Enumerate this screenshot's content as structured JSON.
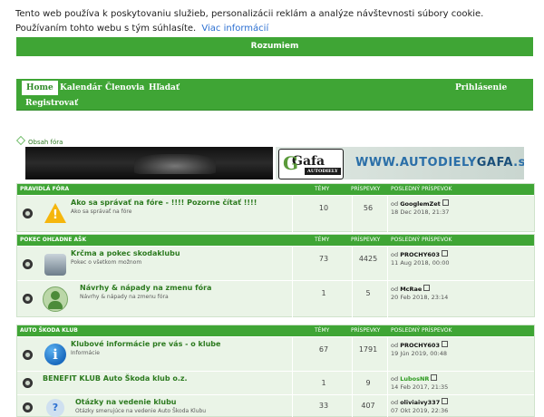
{
  "cookie": {
    "text": "Tento web používa k poskytovaniu služieb, personalizácii reklám a analýze návštevnosti súbory cookie. Používaním tohto webu s tým súhlasíte.",
    "more_link": "Viac informácií",
    "accept_label": "Rozumiem"
  },
  "nav": {
    "items": [
      "Home",
      "Kalendár",
      "Členovia",
      "Hľadať"
    ],
    "register": "Registrovať",
    "login": "Prihlásenie"
  },
  "breadcrumb": {
    "label": "Obsah fóra"
  },
  "banners": {
    "right": {
      "logo": "Gafa",
      "logo_sub": "AUTODIELY",
      "url_a": "WWW.AUTODIELY",
      "url_b": "GAFA",
      "url_c": ".sk"
    }
  },
  "colors": {
    "accent": "#3fa535",
    "link": "#2c7a1f"
  },
  "columns": {
    "topics": "TÉMY",
    "posts": "PRÍSPEVKY",
    "last_post": "POSLEDNÝ PRÍSPEVOK"
  },
  "categories": [
    {
      "name": "PRAVIDLÁ FÓRA",
      "forums": [
        {
          "icon": "warning-icon",
          "title": "Ako sa správať na fóre - !!!! Pozorne čítať !!!!",
          "desc": "Ako sa správať na fóre",
          "topics": "10",
          "posts": "56",
          "last_prefix": "od",
          "last_user": "GooglemZet",
          "last_date": "18 Dec 2018, 21:37"
        }
      ]
    },
    {
      "name": "POKEC OHĽADNE AŠK",
      "forums": [
        {
          "icon": "robot-icon",
          "title": "Krčma a pokec skodaklubu",
          "desc": "Pokec o všetkom možnom",
          "topics": "73",
          "posts": "4425",
          "last_prefix": "od",
          "last_user": "PROCHY603",
          "last_date": "11 Aug 2018, 00:00"
        },
        {
          "icon": "avatar-icon",
          "title": "Návrhy & nápady na zmenu fóra",
          "desc": "Návrhy & nápady na zmenu fóra",
          "topics": "1",
          "posts": "5",
          "last_prefix": "od",
          "last_user": "McRae",
          "last_date": "20 Feb 2018, 23:14"
        }
      ]
    },
    {
      "name": "AUTO ŠKODA KLUB",
      "forums": [
        {
          "icon": "info-icon",
          "title": "Klubové informácie pre vás - o klube",
          "desc": "Informácie",
          "topics": "67",
          "posts": "1791",
          "last_prefix": "od",
          "last_user": "PROCHY603",
          "last_date": "19 Jún 2019, 00:48"
        },
        {
          "icon": "none",
          "title": "BENEFIT KLUB Auto Škoda klub o.z.",
          "desc": "",
          "topics": "1",
          "posts": "9",
          "last_prefix": "od",
          "last_user": "LubosNR",
          "last_date": "14 Feb 2017, 21:35"
        },
        {
          "icon": "question-icon",
          "title": "Otázky na vedenie klubu",
          "desc": "Otázky smerujúce na vedenie Auto Škoda Klubu",
          "topics": "33",
          "posts": "407",
          "last_prefix": "od",
          "last_user": "oliviaivy337",
          "last_date": "07 Okt 2019, 22:36"
        }
      ]
    }
  ]
}
